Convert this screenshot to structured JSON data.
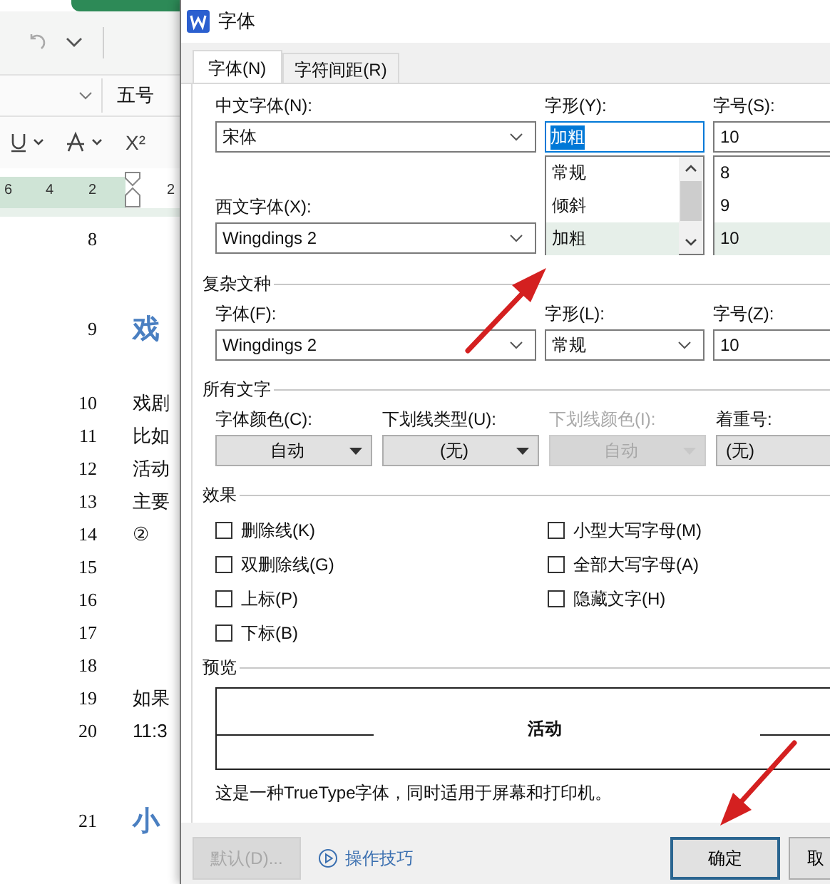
{
  "document": {
    "toolbar": {
      "font_size": "五号",
      "superscript_label": "X²"
    },
    "ruler_ticks": [
      "6",
      "4",
      "2",
      "2"
    ],
    "lines": [
      {
        "number": "8",
        "kind": "body"
      },
      {
        "number": "9",
        "kind": "heading",
        "text": "戏"
      },
      {
        "number": "10",
        "kind": "body",
        "text": "戏剧"
      },
      {
        "number": "11",
        "kind": "body",
        "text": "比如"
      },
      {
        "number": "12",
        "kind": "body",
        "text": "活动"
      },
      {
        "number": "13",
        "kind": "body",
        "text": "主要"
      },
      {
        "number": "14",
        "kind": "body",
        "text": "②"
      },
      {
        "number": "15",
        "kind": "body"
      },
      {
        "number": "16",
        "kind": "body"
      },
      {
        "number": "17",
        "kind": "body"
      },
      {
        "number": "18",
        "kind": "body"
      },
      {
        "number": "19",
        "kind": "body",
        "text": "如果"
      },
      {
        "number": "20",
        "kind": "body",
        "text": "11:3"
      },
      {
        "number": "21",
        "kind": "heading",
        "text": "小"
      }
    ]
  },
  "dialog": {
    "title": "字体",
    "tabs": [
      {
        "label": "字体(N)",
        "selected": true
      },
      {
        "label": "字符间距(R)",
        "selected": false
      }
    ],
    "chinese_font": {
      "label": "中文字体(N):",
      "value": "宋体"
    },
    "western_font": {
      "label": "西文字体(X):",
      "value": "Wingdings 2"
    },
    "style": {
      "label": "字形(Y):",
      "value": "加粗",
      "options": [
        {
          "label": "常规",
          "selected": false
        },
        {
          "label": "倾斜",
          "selected": false
        },
        {
          "label": "加粗",
          "selected": true
        }
      ]
    },
    "size": {
      "label": "字号(S):",
      "value": "10",
      "options": [
        {
          "label": "8",
          "selected": false
        },
        {
          "label": "9",
          "selected": false
        },
        {
          "label": "10",
          "selected": true
        }
      ]
    },
    "complex": {
      "title": "复杂文种",
      "fields": [
        {
          "label": "字体(F):",
          "value": "Wingdings 2",
          "kind": "combo"
        },
        {
          "label": "字形(L):",
          "value": "常规",
          "kind": "combo"
        },
        {
          "label": "字号(Z):",
          "value": "10",
          "kind": "text"
        }
      ]
    },
    "all_text": {
      "title": "所有文字",
      "fields": [
        {
          "label": "字体颜色(C):",
          "value": "自动",
          "disabled": false
        },
        {
          "label": "下划线类型(U):",
          "value": "(无)",
          "disabled": false
        },
        {
          "label": "下划线颜色(I):",
          "value": "自动",
          "disabled": true
        },
        {
          "label": "着重号:",
          "value": "(无)",
          "disabled": false
        }
      ]
    },
    "effects": {
      "title": "效果",
      "options": [
        {
          "label": "删除线(K)",
          "checked": false
        },
        {
          "label": "双删除线(G)",
          "checked": false
        },
        {
          "label": "上标(P)",
          "checked": false
        },
        {
          "label": "下标(B)",
          "checked": false
        },
        {
          "label": "小型大写字母(M)",
          "checked": false
        },
        {
          "label": "全部大写字母(A)",
          "checked": false
        },
        {
          "label": "隐藏文字(H)",
          "checked": false
        }
      ]
    },
    "preview": {
      "title": "预览",
      "sample": "活动",
      "note": "这是一种TrueType字体，同时适用于屏幕和打印机。"
    },
    "footer": {
      "default_button": {
        "label": "默认(D)...",
        "disabled": true
      },
      "tips_link": "操作技巧",
      "buttons": [
        {
          "label": "确定",
          "kind": "primary"
        },
        {
          "label": "取",
          "kind": "normal"
        }
      ]
    }
  }
}
